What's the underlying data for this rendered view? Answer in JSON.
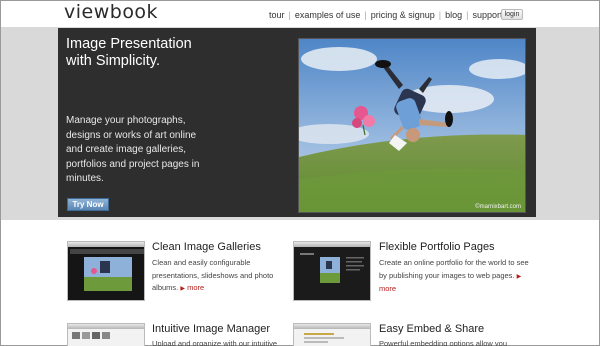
{
  "header": {
    "logo": "viewbook",
    "nav": [
      "tour",
      "examples of use",
      "pricing & signup",
      "blog",
      "support"
    ],
    "login_label": "login"
  },
  "hero": {
    "title_lines": [
      "Image Presentation",
      "with Simplicity."
    ],
    "description": "Manage your photographs, designs or works of art online and create image galleries, portfolios and project pages in minutes.",
    "button_label": "Try Now",
    "photo_credit": "©marnixbart.com"
  },
  "features": [
    {
      "title": "Clean Image Galleries",
      "description": "Clean and easily configurable presentations, slideshows and photo albums.",
      "more_label": "more"
    },
    {
      "title": "Flexible Portfolio Pages",
      "description": "Create an online portfolio for the world to see by publishing your images to web pages.",
      "more_label": "more"
    },
    {
      "title": "Intuitive Image Manager",
      "description": "Upload and organize with our intuitive"
    },
    {
      "title": "Easy Embed & Share",
      "description": "Powerful embedding options allow you"
    }
  ],
  "colors": {
    "hero_bg": "#2e2e2e",
    "band_bg": "#d9d9d9",
    "button": "#5a86b4",
    "more_link": "#b41e1e"
  }
}
